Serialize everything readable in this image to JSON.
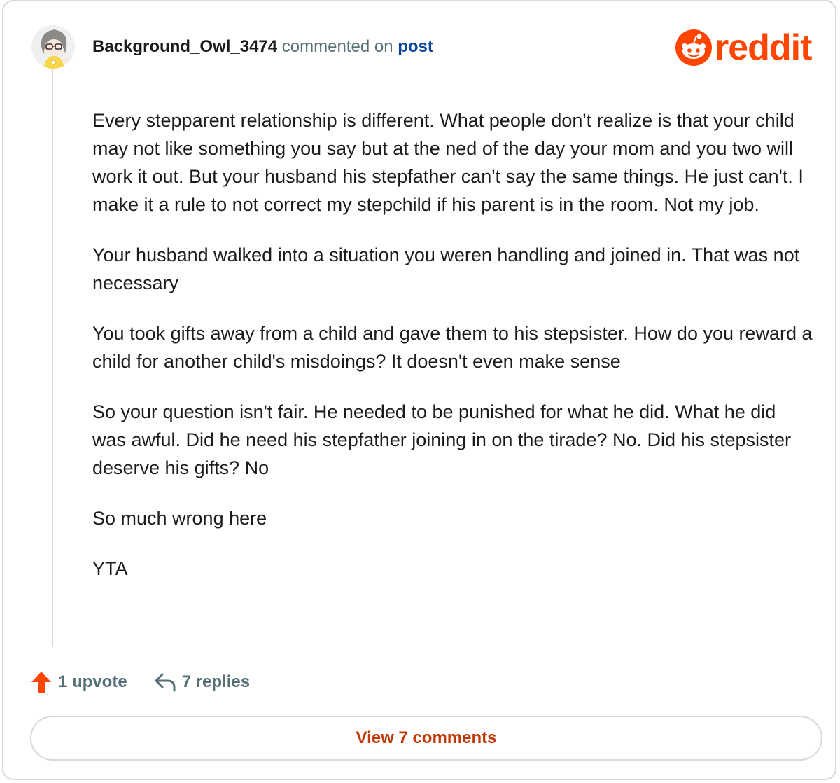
{
  "header": {
    "username": "Background_Owl_3474",
    "action_text": "commented on",
    "post_link": "post"
  },
  "logo": {
    "text": "reddit",
    "icon": "reddit-snoo-icon",
    "color": "#ff4500"
  },
  "comment": {
    "paragraphs": [
      "Every stepparent relationship is different. What people don't realize is that your child may not like something you say but at the ned of the day your mom and you two will work it out. But your husband his stepfather can't say the same things. He just can't. I make it a rule to not correct my stepchild if his parent is in the room. Not my job.",
      "Your husband walked into a situation you weren handling and joined in. That was not necessary",
      "You took gifts away from a child and gave them to his stepsister. How do you reward a child for another child's misdoings? It doesn't even make sense",
      "So your question isn't fair. He needed to be punished for what he did. What he did was awful. Did he need his stepfather joining in on the tirade? No. Did his stepsister deserve his gifts? No",
      "So much wrong here",
      "YTA"
    ]
  },
  "actions": {
    "upvote_label": "1 upvote",
    "upvote_icon": "upvote-arrow-icon",
    "replies_label": "7 replies",
    "replies_icon": "reply-arrow-icon"
  },
  "footer": {
    "view_comments_label": "View 7 comments"
  },
  "colors": {
    "brand": "#ff4500",
    "link": "#0a449b",
    "muted": "#576f76",
    "button_text": "#c23a0a"
  }
}
